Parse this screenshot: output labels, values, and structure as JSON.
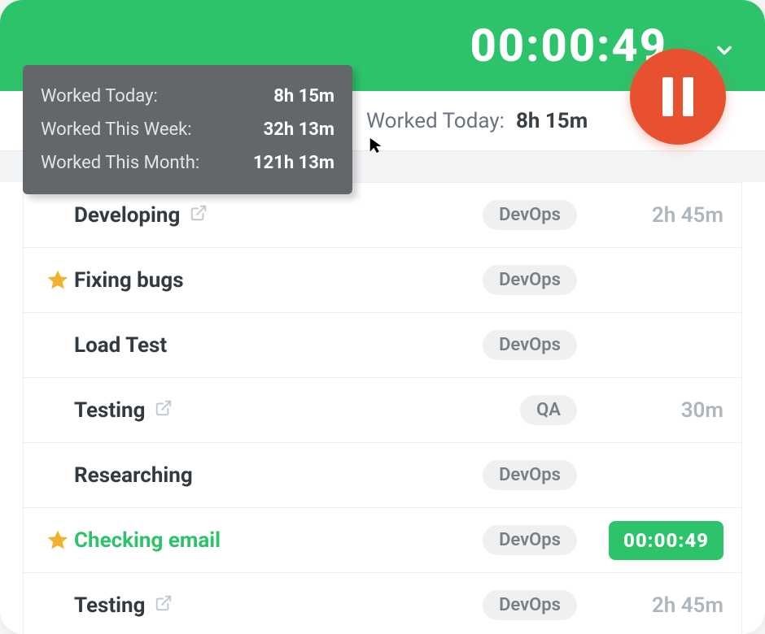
{
  "header": {
    "timer": "00:00:49"
  },
  "summary": {
    "label": "Worked Today:",
    "value": "8h 15m"
  },
  "tooltip": {
    "rows": [
      {
        "label": "Worked Today:",
        "value": "8h 15m"
      },
      {
        "label": "Worked This Week:",
        "value": "32h 13m"
      },
      {
        "label": "Worked This Month:",
        "value": "121h 13m"
      }
    ]
  },
  "tasks": [
    {
      "title": "Developing",
      "tag": "DevOps",
      "time": "2h 45m",
      "starred": false,
      "external": true,
      "active": false
    },
    {
      "title": "Fixing bugs",
      "tag": "DevOps",
      "time": "",
      "starred": true,
      "external": false,
      "active": false
    },
    {
      "title": "Load Test",
      "tag": "DevOps",
      "time": "",
      "starred": false,
      "external": false,
      "active": false
    },
    {
      "title": "Testing",
      "tag": "QA",
      "time": "30m",
      "starred": false,
      "external": true,
      "active": false
    },
    {
      "title": "Researching",
      "tag": "DevOps",
      "time": "",
      "starred": false,
      "external": false,
      "active": false
    },
    {
      "title": "Checking email",
      "tag": "DevOps",
      "time": "00:00:49",
      "starred": true,
      "external": false,
      "active": true
    },
    {
      "title": "Testing",
      "tag": "DevOps",
      "time": "2h 45m",
      "starred": false,
      "external": true,
      "active": false
    }
  ],
  "colors": {
    "accent_green": "#2cc36b",
    "accent_orange": "#e8512f",
    "tooltip_bg": "#62676c"
  }
}
